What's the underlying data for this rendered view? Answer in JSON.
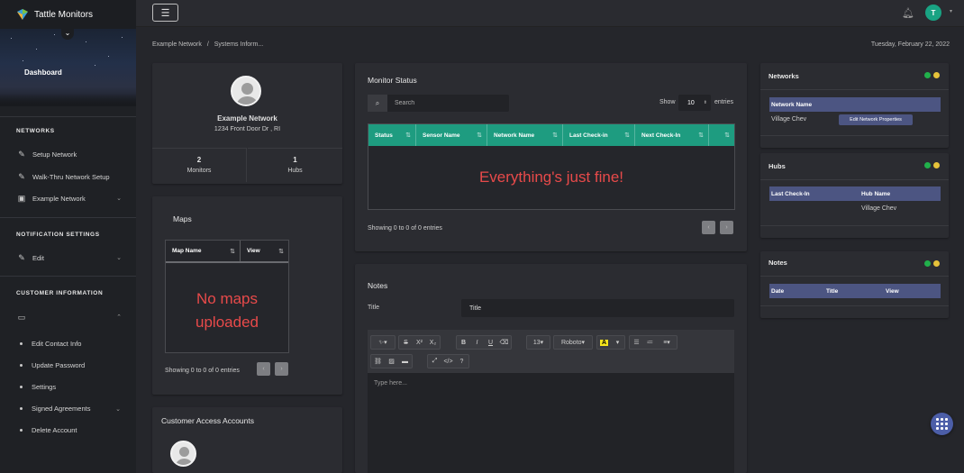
{
  "app": {
    "brand": "Tattle Monitors",
    "dashboard_label": "Dashboard"
  },
  "sidebar": {
    "sections": [
      {
        "title": "NETWORKS"
      },
      {
        "title": "NOTIFICATION SETTINGS"
      },
      {
        "title": "CUSTOMER INFORMATION"
      }
    ],
    "items": [
      {
        "label": "Setup Network",
        "icon": "pencil-icon"
      },
      {
        "label": "Walk-Thru Network Setup",
        "icon": "pencil-icon"
      },
      {
        "label": "Example Network",
        "icon": "network-icon"
      },
      {
        "label": "Edit",
        "icon": "pencil-icon"
      }
    ],
    "sub_items": [
      {
        "label": "Edit Contact Info"
      },
      {
        "label": "Update Password"
      },
      {
        "label": "Settings"
      },
      {
        "label": "Signed Agreements"
      },
      {
        "label": "Delete Account"
      }
    ]
  },
  "topbar": {
    "avatar_initial": "T"
  },
  "breadcrumb": {
    "root": "Example Network",
    "sep": "/",
    "current": "Systems Inform..."
  },
  "date": "Tuesday, February 22, 2022",
  "profile": {
    "name": "Example Network",
    "address": "1234 Front Door Dr , RI",
    "monitors_count": "2",
    "monitors_label": "Monitors",
    "hubs_count": "1",
    "hubs_label": "Hubs"
  },
  "maps": {
    "title": "Maps",
    "columns": [
      "Map Name",
      "View"
    ],
    "empty_line1": "No maps",
    "empty_line2": "uploaded",
    "footer": "Showing 0 to 0 of 0 entries"
  },
  "customer_access": {
    "title": "Customer Access Accounts"
  },
  "monitor_status": {
    "title": "Monitor Status",
    "search_placeholder": "Search",
    "show_label": "Show",
    "show_value": "10",
    "entries_label": "entries",
    "columns": [
      "Status",
      "Sensor Name",
      "Network Name",
      "Last Check-in",
      "Next Check-In"
    ],
    "empty_message": "Everything's just fine!",
    "footer": "Showing 0 to 0 of 0 entries"
  },
  "notes": {
    "title": "Notes",
    "title_label": "Title",
    "title_placeholder": "Title",
    "font_size": "13",
    "font_name": "Roboto",
    "editor_placeholder": "Type here..."
  },
  "networks_panel": {
    "title": "Networks",
    "column": "Network Name",
    "row_value": "Village Chev",
    "edit_button": "Edit Network Properties"
  },
  "hubs_panel": {
    "title": "Hubs",
    "columns": [
      "Last Check-In",
      "Hub Name"
    ],
    "row_hub": "Village Chev"
  },
  "notes_panel": {
    "title": "Notes",
    "columns": [
      "Date",
      "Title",
      "View"
    ]
  },
  "colors": {
    "teal_header": "#1e9c80",
    "indigo_header": "#4c5582",
    "status_green": "#21b04b",
    "status_yellow": "#e6c23a",
    "empty_red": "#e84a4a",
    "avatar_green": "#19a383"
  }
}
